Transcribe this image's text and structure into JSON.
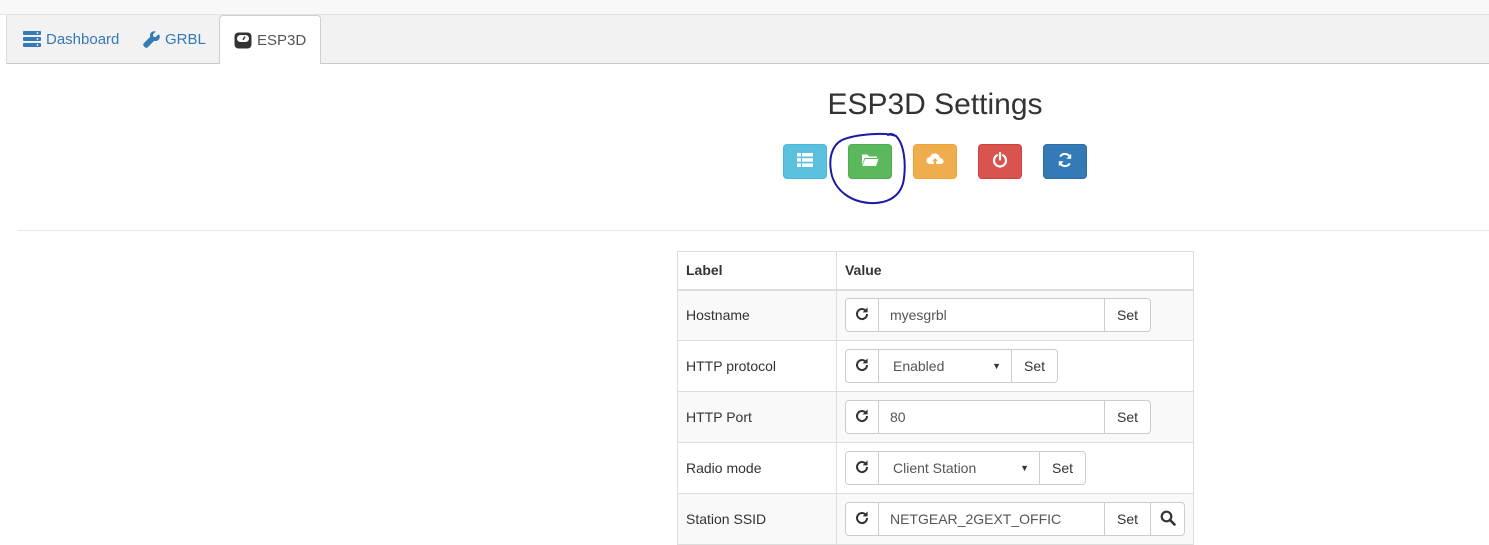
{
  "tabs": [
    {
      "label": "Dashboard",
      "icon": "server-icon"
    },
    {
      "label": "GRBL",
      "icon": "wrench-icon"
    },
    {
      "label": "ESP3D",
      "icon": "scale-icon",
      "active": true
    }
  ],
  "page_title": "ESP3D Settings",
  "toolbar": [
    {
      "name": "list-button",
      "icon": "list-icon",
      "color": "#5bc0de"
    },
    {
      "name": "open-folder-button",
      "icon": "folder-open-icon",
      "color": "#5cb85c",
      "highlighted": true
    },
    {
      "name": "cloud-upload-button",
      "icon": "cloud-upload-icon",
      "color": "#f0ad4e"
    },
    {
      "name": "power-button",
      "icon": "power-icon",
      "color": "#d9534f"
    },
    {
      "name": "refresh-button",
      "icon": "refresh-icon",
      "color": "#337ab7"
    }
  ],
  "table": {
    "headers": {
      "label": "Label",
      "value": "Value"
    },
    "rows": [
      {
        "label": "Hostname",
        "type": "text",
        "value": "myesgrbl",
        "set": "Set"
      },
      {
        "label": "HTTP protocol",
        "type": "select",
        "value": "Enabled",
        "set": "Set"
      },
      {
        "label": "HTTP Port",
        "type": "text",
        "value": "80",
        "set": "Set"
      },
      {
        "label": "Radio mode",
        "type": "select",
        "value": "Client Station",
        "set": "Set"
      },
      {
        "label": "Station SSID",
        "type": "text",
        "value": "NETGEAR_2GEXT_OFFIC",
        "set": "Set"
      }
    ]
  },
  "colors": {
    "link": "#337ab7",
    "annotation": "#1a1aa8"
  }
}
